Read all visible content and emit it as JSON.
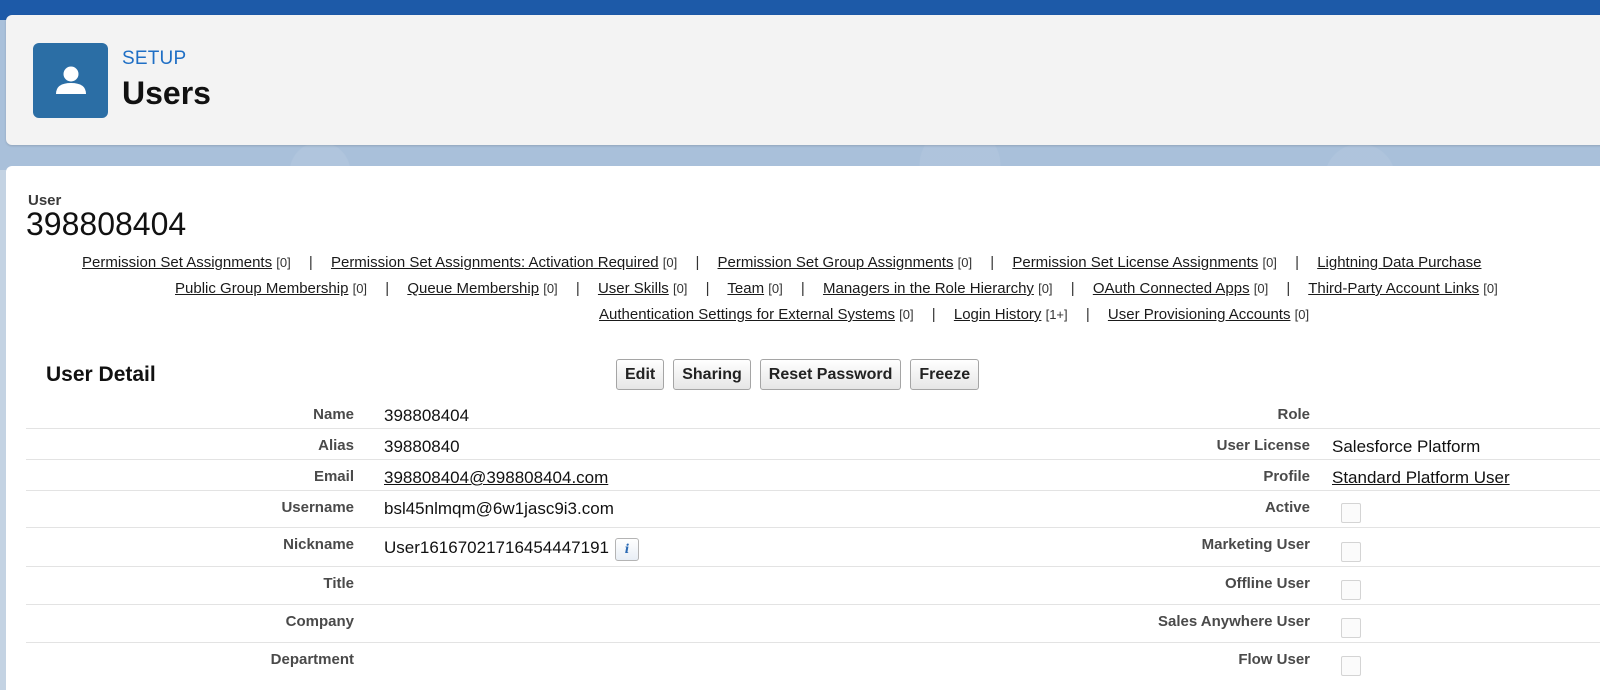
{
  "header": {
    "setup_label": "SETUP",
    "title": "Users",
    "icon": "user-icon"
  },
  "record": {
    "type_label": "User",
    "name": "398808404"
  },
  "related_links": [
    [
      {
        "label": "Permission Set Assignments",
        "count": "[0]"
      },
      {
        "label": "Permission Set Assignments: Activation Required",
        "count": "[0]"
      },
      {
        "label": "Permission Set Group Assignments",
        "count": "[0]"
      },
      {
        "label": "Permission Set License Assignments",
        "count": "[0]"
      },
      {
        "label": "Lightning Data Purchase",
        "count": ""
      }
    ],
    [
      {
        "label": "Public Group Membership",
        "count": "[0]"
      },
      {
        "label": "Queue Membership",
        "count": "[0]"
      },
      {
        "label": "User Skills",
        "count": "[0]"
      },
      {
        "label": "Team",
        "count": "[0]"
      },
      {
        "label": "Managers in the Role Hierarchy",
        "count": "[0]"
      },
      {
        "label": "OAuth Connected Apps",
        "count": "[0]"
      },
      {
        "label": "Third-Party Account Links",
        "count": "[0]"
      }
    ],
    [
      {
        "label": "Authentication Settings for External Systems",
        "count": "[0]"
      },
      {
        "label": "Login History",
        "count": "[1+]"
      },
      {
        "label": "User Provisioning Accounts",
        "count": "[0]"
      }
    ]
  ],
  "detail": {
    "title": "User Detail",
    "buttons": {
      "edit": "Edit",
      "sharing": "Sharing",
      "reset_password": "Reset Password",
      "freeze": "Freeze"
    },
    "left": {
      "name_label": "Name",
      "name_value": "398808404",
      "alias_label": "Alias",
      "alias_value": "39880840",
      "email_label": "Email",
      "email_value": "398808404@398808404.com",
      "username_label": "Username",
      "username_value": "bsl45nlmqm@6w1jasc9i3.com",
      "nickname_label": "Nickname",
      "nickname_value": "User16167021716454447191",
      "title_label": "Title",
      "title_value": "",
      "company_label": "Company",
      "company_value": "",
      "department_label": "Department",
      "department_value": ""
    },
    "right": {
      "role_label": "Role",
      "role_value": "",
      "license_label": "User License",
      "license_value": "Salesforce Platform",
      "profile_label": "Profile",
      "profile_value": "Standard Platform User",
      "active_label": "Active",
      "active_checked": false,
      "marketing_label": "Marketing User",
      "marketing_checked": false,
      "offline_label": "Offline User",
      "offline_checked": false,
      "sales_anywhere_label": "Sales Anywhere User",
      "sales_anywhere_checked": false,
      "flow_label": "Flow User",
      "flow_checked": false
    },
    "info_icon": "info-icon",
    "info_glyph": "i"
  }
}
